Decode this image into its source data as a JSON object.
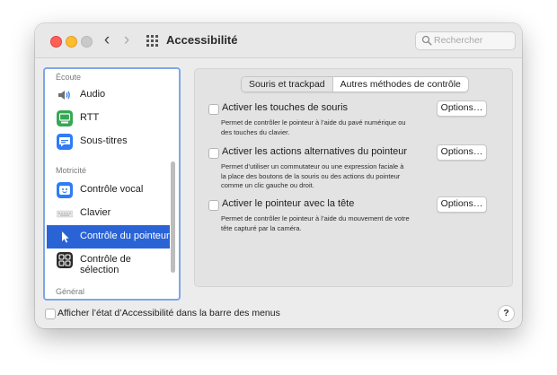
{
  "window": {
    "title": "Accessibilité",
    "nav_back": "‹",
    "nav_forward": "›"
  },
  "search": {
    "placeholder": "Rechercher",
    "value": ""
  },
  "sidebar": {
    "sections": [
      {
        "label": "Écoute"
      },
      {
        "label": "Motricité"
      },
      {
        "label": "Général"
      }
    ],
    "items": [
      {
        "label": "Audio",
        "icon": "speaker-icon"
      },
      {
        "label": "RTT",
        "icon": "rtt-icon"
      },
      {
        "label": "Sous-titres",
        "icon": "captions-icon"
      },
      {
        "label": "Contrôle vocal",
        "icon": "voice-control-icon"
      },
      {
        "label": "Clavier",
        "icon": "keyboard-icon"
      },
      {
        "label": "Contrôle du pointeur",
        "icon": "pointer-icon",
        "selected": true
      },
      {
        "label": "Contrôle de sélection",
        "icon": "switch-control-icon"
      }
    ]
  },
  "tabs": [
    {
      "label": "Souris et trackpad",
      "active": true
    },
    {
      "label": "Autres méthodes de contrôle",
      "active": false
    }
  ],
  "options": [
    {
      "title": "Activer les touches de souris",
      "description": "Permet de contrôler le pointeur à l’aide du pavé numérique ou des touches du clavier.",
      "button": "Options…",
      "checked": false
    },
    {
      "title": "Activer les actions alternatives du pointeur",
      "description": "Permet d’utiliser un commutateur ou une expression faciale à la place des boutons de la souris ou des actions du pointeur comme un clic gauche ou droit.",
      "button": "Options…",
      "checked": false
    },
    {
      "title": "Activer le pointeur avec la tête",
      "description": "Permet de contrôler le pointeur à l’aide du mouvement de votre tête capturé par la caméra.",
      "button": "Options…",
      "checked": false
    }
  ],
  "footer": {
    "menubar_label": "Afficher l’état d’Accessibilité dans la barre des menus",
    "menubar_checked": false,
    "help_label": "?"
  },
  "colors": {
    "selection": "#2a63d6",
    "sidebar_focus_ring": "#7fa6ea",
    "close": "#fe5f57",
    "minimize": "#febc2e",
    "rtt_green": "#35a853",
    "blue_icon": "#2f7cf6"
  }
}
